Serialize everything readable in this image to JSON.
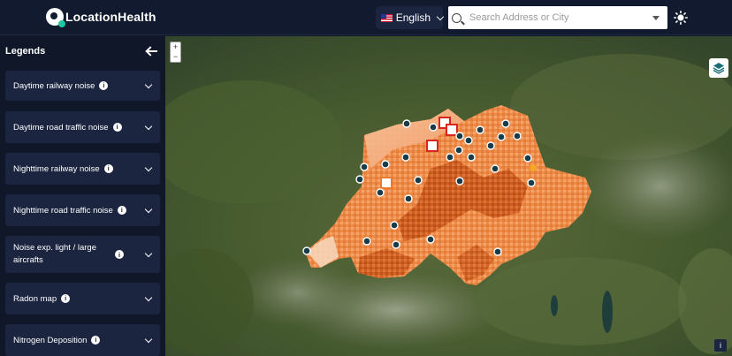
{
  "header": {
    "app_name": "LocationHealth",
    "language": "English",
    "search_placeholder": "Search Address or City"
  },
  "icons": {
    "logo": "location-pin-logo",
    "flag": "us-flag-icon",
    "search": "search-icon",
    "theme": "sun-icon",
    "collapse": "arrow-left-icon",
    "layers": "layers-icon"
  },
  "sidebar": {
    "title": "Legends",
    "items": [
      {
        "label": "Daytime railway noise"
      },
      {
        "label": "Daytime road traffic noise"
      },
      {
        "label": "Nighttime railway noise"
      },
      {
        "label": "Nighttime road traffic noise"
      },
      {
        "label": "Noise exp. light / large aircrafts"
      },
      {
        "label": "Radon map"
      },
      {
        "label": "Nitrogen Deposition"
      }
    ]
  },
  "map": {
    "zoom_in": "+",
    "zoom_out": "−",
    "info": "i"
  },
  "colors": {
    "accent": "#1fc8a5",
    "panel": "#1b2540",
    "background": "#0f1729",
    "overlay_light": "#f6b07a",
    "overlay_dark": "#c84a10"
  }
}
